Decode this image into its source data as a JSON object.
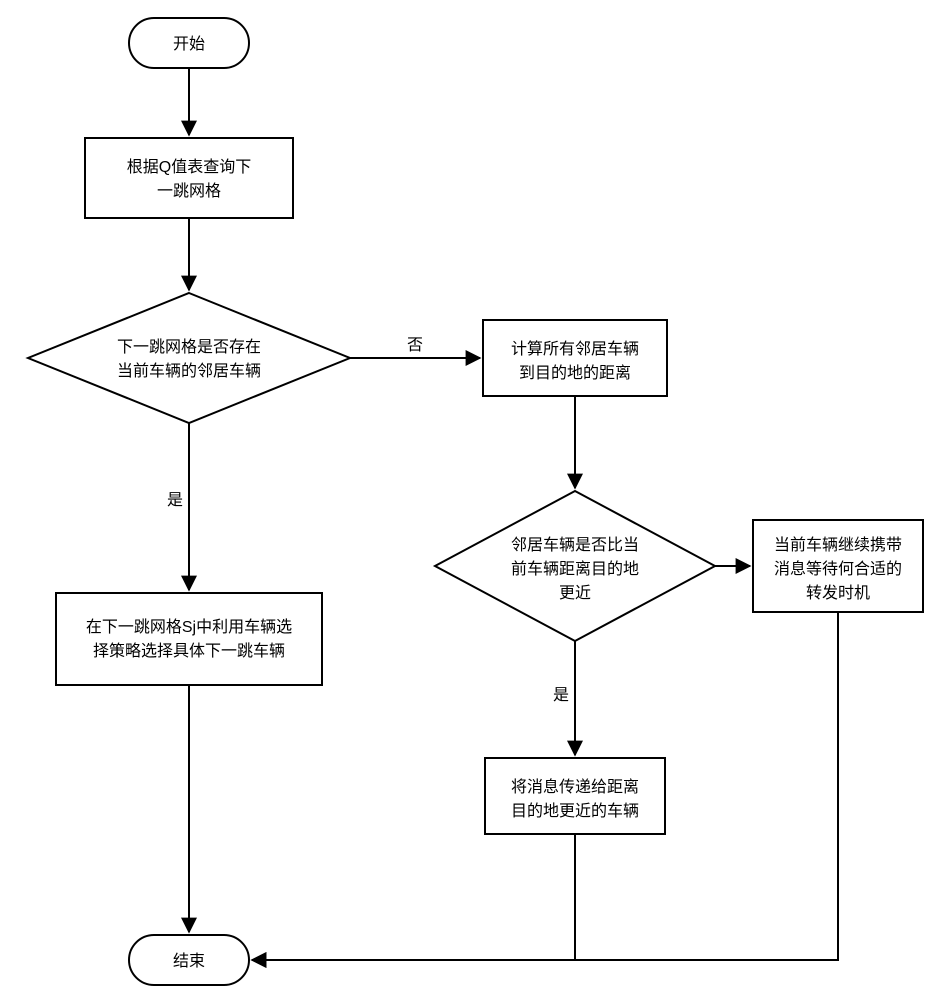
{
  "flowchart": {
    "start": "开始",
    "end": "结束",
    "nodes": {
      "query_q_table": {
        "line1": "根据Q值表查询下",
        "line2": "一跳网格"
      },
      "decision_neighbor_exists": {
        "line1": "下一跳网格是否存在",
        "line2": "当前车辆的邻居车辆"
      },
      "calc_distance": {
        "line1": "计算所有邻居车辆",
        "line2": "到目的地的距离"
      },
      "select_vehicle": {
        "line1": "在下一跳网格Sj中利用车辆选",
        "line2": "择策略选择具体下一跳车辆"
      },
      "decision_closer": {
        "line1": "邻居车辆是否比当",
        "line2": "前车辆距离目的地",
        "line3": "更近"
      },
      "carry_message": {
        "line1": "当前车辆继续携带",
        "line2": "消息等待何合适的",
        "line3": "转发时机"
      },
      "forward_message": {
        "line1": "将消息传递给距离",
        "line2": "目的地更近的车辆"
      }
    },
    "edges": {
      "yes": "是",
      "no": "否"
    }
  }
}
